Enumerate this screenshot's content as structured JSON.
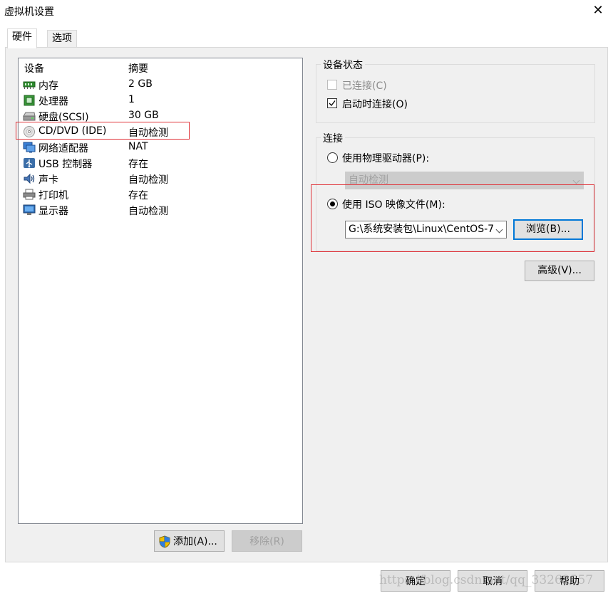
{
  "window": {
    "title": "虚拟机设置",
    "close_glyph": "✕"
  },
  "tabs": [
    {
      "label": "硬件"
    },
    {
      "label": "选项"
    }
  ],
  "device_list": {
    "col_device": "设备",
    "col_summary": "摘要",
    "rows": [
      {
        "name": "内存",
        "summary": "2 GB",
        "icon": "memory-icon"
      },
      {
        "name": "处理器",
        "summary": "1",
        "icon": "processor-icon"
      },
      {
        "name": "硬盘(SCSI)",
        "summary": "30 GB",
        "icon": "harddisk-icon"
      },
      {
        "name": "CD/DVD (IDE)",
        "summary": "自动检测",
        "icon": "cd-dvd-icon"
      },
      {
        "name": "网络适配器",
        "summary": "NAT",
        "icon": "network-adapter-icon"
      },
      {
        "name": "USB 控制器",
        "summary": "存在",
        "icon": "usb-icon"
      },
      {
        "name": "声卡",
        "summary": "自动检测",
        "icon": "sound-card-icon"
      },
      {
        "name": "打印机",
        "summary": "存在",
        "icon": "printer-icon"
      },
      {
        "name": "显示器",
        "summary": "自动检测",
        "icon": "display-icon"
      }
    ],
    "selected_index": 3
  },
  "buttons": {
    "add": "添加(A)...",
    "remove": "移除(R)"
  },
  "device_status": {
    "label": "设备状态",
    "connected": {
      "label": "已连接(C)",
      "checked": false,
      "enabled": false
    },
    "connect_at_power_on": {
      "label": "启动时连接(O)",
      "checked": true
    }
  },
  "connection": {
    "label": "连接",
    "physical": {
      "label": "使用物理驱动器(P):",
      "selected": false
    },
    "physical_combo": "自动检测",
    "iso": {
      "label": "使用 ISO 映像文件(M):",
      "selected": true
    },
    "iso_path": "G:\\系统安装包\\Linux\\CentOS-7",
    "browse": "浏览(B)..."
  },
  "advanced": "高级(V)...",
  "footer": {
    "ok": "确定",
    "cancel": "取消",
    "help": "帮助"
  },
  "watermark": "https://blog.csdn.net/qq_33262557",
  "colors": {
    "highlight_box": "#e0343a",
    "focus_border": "#0078d7"
  }
}
